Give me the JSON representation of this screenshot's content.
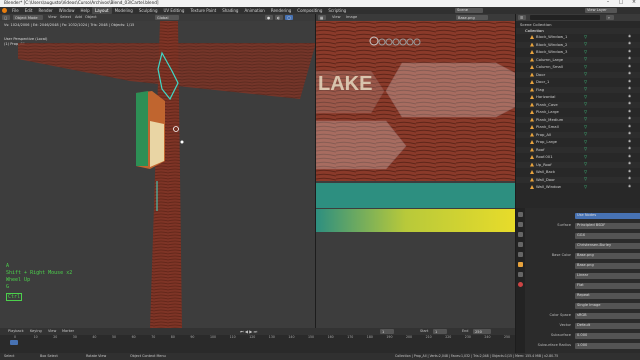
{
  "title": "Blender* [C:\\Users\\augusto\\Videos\\Curso\\Archivos\\Blend_03\\Cartel.blend]",
  "menus": [
    "File",
    "Edit",
    "Render",
    "Window",
    "Help"
  ],
  "workspaces": [
    "Layout",
    "Modeling",
    "Sculpting",
    "UV Editing",
    "Texture Paint",
    "Shading",
    "Animation",
    "Rendering",
    "Compositing",
    "Scripting"
  ],
  "active_workspace": "Layout",
  "top_right": {
    "scene": "Scene",
    "view_layer": "View Layer"
  },
  "viewport": {
    "mode": "Object Mode",
    "menus": [
      "View",
      "Select",
      "Add",
      "Object"
    ],
    "orientation": "Global",
    "info_line": "Vs: 1024/2006 | Ed: 2046/2048 | Fa: 1032/1024 | Tris: 2048 | Objects: 1/15",
    "view_name": "User Perspective (Local)",
    "object_name": "(1) Prop_All",
    "key_hint_1": "A",
    "key_hint_2": "Shift + Right Mouse x2",
    "key_hint_3": "Wheel Up",
    "key_hint_4": "G",
    "key_hint_5": "Ctrl"
  },
  "image_editor": {
    "menus": [
      "View",
      "Image"
    ],
    "image_name": "Base.png",
    "sign_text": "LAKE"
  },
  "outliner": {
    "search_placeholder": "",
    "root": "Scene Collection",
    "collection": "Collection",
    "items": [
      "Block_Window_1",
      "Block_Window_2",
      "Block_Window_3",
      "Column_Large",
      "Column_Small",
      "Door",
      "Door_1",
      "Flag",
      "Horizontal",
      "Plank_Cave",
      "Plank_Large",
      "Plank_Medium",
      "Plank_Small",
      "Prop_All",
      "Prop_Large",
      "Roof",
      "Roof.001",
      "Up_Roof",
      "Wall_Back",
      "Wall_Door",
      "Wall_Window"
    ]
  },
  "properties": {
    "rows": [
      {
        "label": "",
        "value": "Use Nodes"
      },
      {
        "label": "Surface",
        "value": "Principled BSDF"
      },
      {
        "label": "",
        "value": "GGX"
      },
      {
        "label": "",
        "value": "Christensen-Burley"
      },
      {
        "label": "Base Color",
        "value": "Base.png"
      },
      {
        "label": "",
        "value": "Base.png"
      },
      {
        "label": "",
        "value": "Linear"
      },
      {
        "label": "",
        "value": "Flat"
      },
      {
        "label": "",
        "value": "Repeat"
      },
      {
        "label": "",
        "value": "Single Image"
      },
      {
        "label": "Color Space",
        "value": "sRGB"
      },
      {
        "label": "Vector",
        "value": "Default"
      },
      {
        "label": "Subsurface",
        "value": "0.000"
      },
      {
        "label": "Subsurface Radius",
        "value": "1.000"
      }
    ]
  },
  "timeline": {
    "menus": [
      "Playback",
      "Keying",
      "View",
      "Marker"
    ],
    "current_frame": "1",
    "start_label": "Start",
    "start_value": "1",
    "end_label": "End",
    "end_value": "250",
    "ticks": [
      "0",
      "10",
      "20",
      "30",
      "40",
      "50",
      "60",
      "70",
      "80",
      "90",
      "100",
      "110",
      "120",
      "130",
      "140",
      "150",
      "160",
      "170",
      "180",
      "190",
      "200",
      "210",
      "220",
      "230",
      "240",
      "250"
    ]
  },
  "statusbar": {
    "left": "Select",
    "mid1": "Box Select",
    "mid2": "Rotate View",
    "mid3": "Object Context Menu",
    "right": "Collection | Prop_All | Verts:2,048 | Faces:1,032 | Tris:2,048 | Objects:1/15 | Mem: 155.4 MiB | v2.80.75"
  },
  "colors": {
    "accent": "#4772b3",
    "active_orange": "#e8a33d",
    "outline_cyan": "#3fd9c8",
    "key_green": "#4cd14c",
    "wood": "#8a3a2a",
    "teal": "#2d8f80",
    "yellow": "#e8dc2a"
  }
}
